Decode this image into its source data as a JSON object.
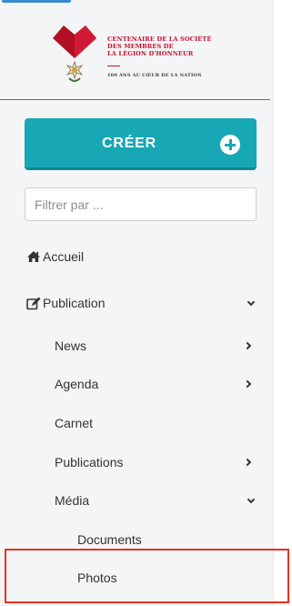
{
  "logo": {
    "line1": "CENTENAIRE DE LA SOCIÉTÉ",
    "line2": "DES MEMBRES DE",
    "line3": "LA LÉGION D'HONNEUR",
    "tagline": "100 ANS AU CŒUR DE LA NATION"
  },
  "create_button": {
    "label": "CRÉER"
  },
  "filter": {
    "placeholder": "Filtrer par ..."
  },
  "nav": {
    "home": "Accueil",
    "publication": "Publication",
    "news": "News",
    "agenda": "Agenda",
    "carnet": "Carnet",
    "publications": "Publications",
    "media": "Média",
    "documents": "Documents",
    "photos": "Photos"
  },
  "colors": {
    "accent": "#18a7b5",
    "brand_red": "#c8102e",
    "highlight": "#e8331c"
  }
}
